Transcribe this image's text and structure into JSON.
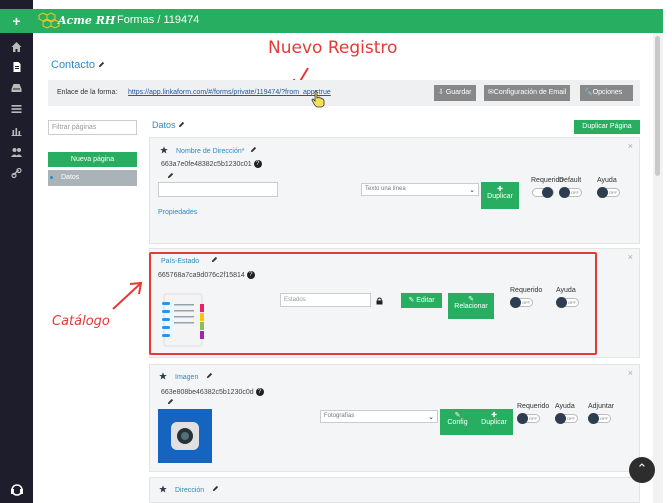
{
  "app": {
    "logo_text": "Acme RH",
    "breadcrumb": "Formas / 119474",
    "add_symbol": "+"
  },
  "sidebar": {
    "icons": [
      "home-icon",
      "document-icon",
      "inbox-icon",
      "list-icon",
      "chart-icon",
      "users-icon",
      "link-icon"
    ],
    "bottom_icon": "support-icon"
  },
  "form": {
    "title": "Contacto",
    "link_label": "Enlace de la forma:",
    "link_url": "https://app.linkaform.com/#/forms/private/119474/?from_app=true",
    "buttons": {
      "guardar": "Guardar",
      "config_email": "Configuración de Email",
      "opciones": "Opciones"
    }
  },
  "annotations": {
    "nuevo_registro": "Nuevo Registro",
    "catalogo": "Catálogo"
  },
  "left_panel": {
    "filter_placeholder": "Filtrar páginas",
    "new_page_button": "Nueva página",
    "pages": [
      "Datos"
    ]
  },
  "main": {
    "section_title": "Datos",
    "duplicate_page_button": "Duplicar Página",
    "fields": [
      {
        "name": "Nombre de Dirección*",
        "id": "663a7e0fe48382c5b1230c01",
        "select_value": "Texto una línea",
        "duplicate_button": "Duplicar",
        "properties_link": "Propiedades",
        "toggles": [
          "Requerido",
          "Default",
          "Ayuda"
        ]
      },
      {
        "name": "País-Estado",
        "id": "665768a7ca9d076c2f15814",
        "input_placeholder": "Estados",
        "edit_button": "Editar",
        "relate_button": "Relacionar",
        "toggles": [
          "Requerido",
          "Ayuda"
        ]
      },
      {
        "name": "Imagen",
        "id": "663e808be46382c5b1230c0d",
        "select_value": "Fotografías",
        "config_button": "Config",
        "duplicate_button": "Duplicar",
        "toggles": [
          "Requerido",
          "Ayuda",
          "Adjuntar"
        ]
      },
      {
        "name": "Dirección"
      }
    ],
    "toggle_off_text": "OFF",
    "close_symbol": "×"
  },
  "colors": {
    "brand_green": "#27ae60",
    "sidebar_dark": "#1d1d2c",
    "link_blue": "#2b8cc4",
    "annotation_red": "#e53935"
  }
}
